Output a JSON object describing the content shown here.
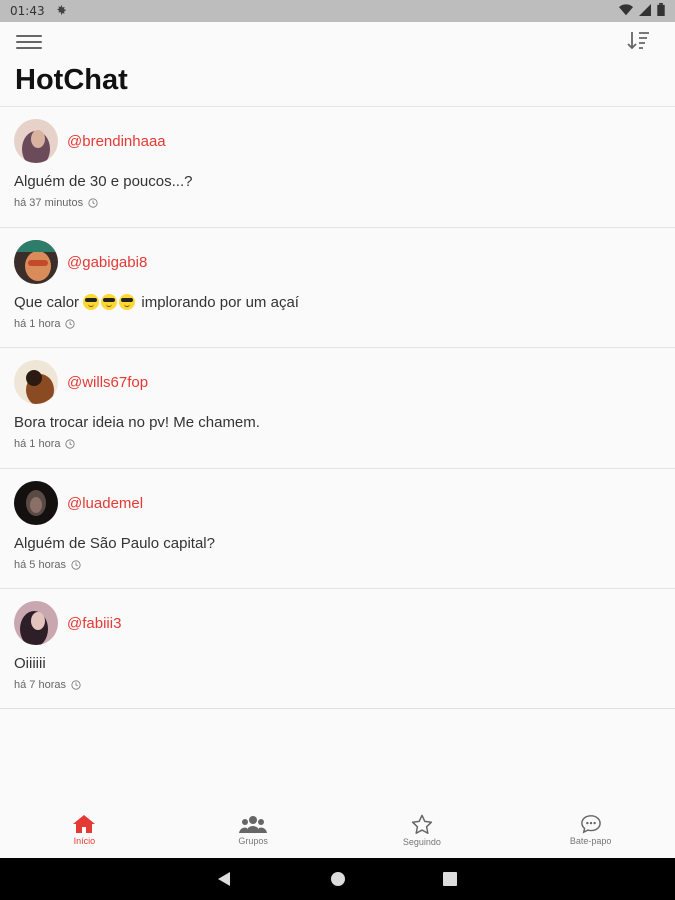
{
  "status_bar": {
    "time": "01:43"
  },
  "app": {
    "title": "HotChat"
  },
  "posts": [
    {
      "username": "@brendinhaaa",
      "message": "Alguém de 30 e poucos...?",
      "time": "há 37 minutos",
      "avatar_colors": [
        "#e6d2c8",
        "#6b4a5a"
      ]
    },
    {
      "username": "@gabigabi8",
      "message_pre": "Que calor ",
      "message_post": " implorando por um açaí",
      "time": "há 1 hora",
      "avatar_colors": [
        "#d98b5a",
        "#3b2e2a"
      ]
    },
    {
      "username": "@wills67fop",
      "message": "Bora trocar ideia no pv! Me chamem.",
      "time": "há 1 hora",
      "avatar_colors": [
        "#f0e6d8",
        "#8a4b22"
      ]
    },
    {
      "username": "@luademel",
      "message": "Alguém de São Paulo capital?",
      "time": "há 5 horas",
      "avatar_colors": [
        "#5a4a44",
        "#141010"
      ]
    },
    {
      "username": "@fabiii3",
      "message": "Oiiiiii",
      "time": "há 7 horas",
      "avatar_colors": [
        "#c9a7b0",
        "#2e1e28"
      ]
    }
  ],
  "bottom_nav": [
    {
      "label": "Início",
      "icon": "home-icon",
      "active": true
    },
    {
      "label": "Grupos",
      "icon": "groups-icon",
      "active": false
    },
    {
      "label": "Seguindo",
      "icon": "star-icon",
      "active": false
    },
    {
      "label": "Bate-papo",
      "icon": "chat-icon",
      "active": false
    }
  ],
  "colors": {
    "accent": "#e53935",
    "nav_inactive": "#777777"
  }
}
